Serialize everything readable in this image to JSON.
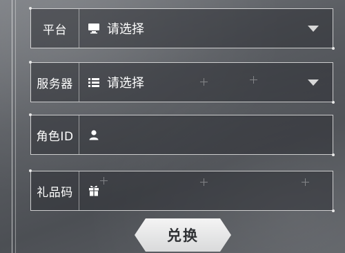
{
  "form": {
    "platform": {
      "label": "平台",
      "value": "请选择",
      "icon": "monitor-icon"
    },
    "server": {
      "label": "服务器",
      "value": "请选择",
      "icon": "list-icon"
    },
    "role_id": {
      "label": "角色ID",
      "value": "",
      "placeholder": "",
      "icon": "user-icon"
    },
    "gift_code": {
      "label": "礼品码",
      "value": "",
      "placeholder": "",
      "icon": "gift-icon"
    }
  },
  "redeem_button": {
    "label": "兑换"
  },
  "colors": {
    "border": "#e6e6e6",
    "field_bg": "#2d2f34",
    "button_bg": "#ebebeb",
    "button_text": "#2f3134"
  }
}
